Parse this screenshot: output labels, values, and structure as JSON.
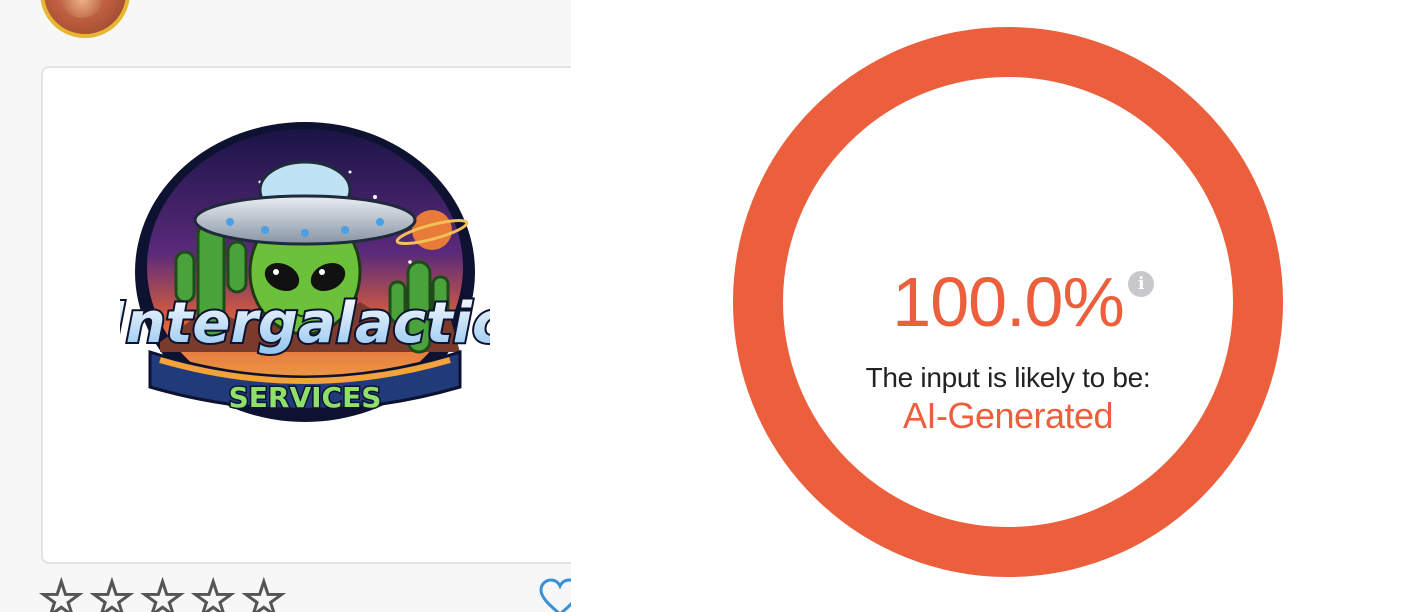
{
  "left": {
    "avatar_alt": "user avatar",
    "logo": {
      "title_text": "Intergalactic",
      "subtitle_text": "SERVICES"
    },
    "rating": {
      "max": 5,
      "filled": 0
    },
    "star_glyph": "☆"
  },
  "result": {
    "score": "100.0%",
    "info_glyph": "i",
    "caption": "The input is likely to be:",
    "verdict": "AI-Generated",
    "accent_color": "#ec5f3c"
  }
}
